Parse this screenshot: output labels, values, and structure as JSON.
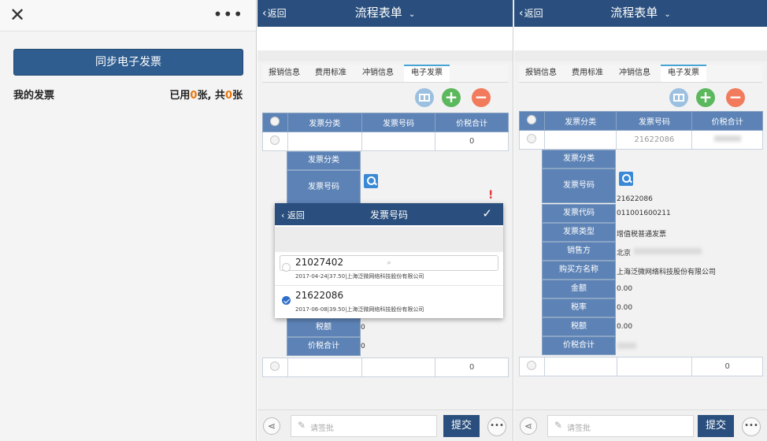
{
  "panel1": {
    "close_icon": "close-icon",
    "more_icon": "more-icon",
    "sync_button": "同步电子发票",
    "my_invoices": "我的发票",
    "count_prefix": "已用",
    "count_used": "0",
    "count_mid": "张, 共",
    "count_total": "0",
    "count_suffix": "张"
  },
  "header": {
    "back": "返回",
    "title": "流程表单"
  },
  "tabs": [
    "报销信息",
    "费用标准",
    "冲销信息",
    "电子发票"
  ],
  "table": {
    "headers": [
      "发票分类",
      "发票号码",
      "价税合计"
    ],
    "row_value": "0"
  },
  "panel2": {
    "detail_labels": [
      "发票分类",
      "发票号码",
      "税额",
      "价税合计"
    ],
    "detail_values": [
      "0",
      "0"
    ],
    "alert": "!",
    "popup": {
      "back": "返回",
      "title": "发票号码",
      "ok": "✓",
      "search_icon": "search-icon",
      "items": [
        {
          "no": "21027402",
          "sub": "2017-04-24|37.50|上海泛微网络科技股份有限公司",
          "selected": false
        },
        {
          "no": "21622086",
          "sub": "2017-06-08|39.50|上海泛微网络科技股份有限公司",
          "selected": true
        }
      ]
    },
    "bottom_row_value": "0"
  },
  "panel3": {
    "row_invoice_no": "21622086",
    "detail_labels": [
      "发票分类",
      "发票号码",
      "发票代码",
      "发票类型",
      "销售方",
      "购买方名称",
      "金额",
      "税率",
      "税额",
      "价税合计"
    ],
    "detail_values": {
      "invoice_no": "21622086",
      "invoice_code": "011001600211",
      "invoice_type": "增值税普通发票",
      "seller": "北京",
      "buyer": "上海泛微网络科技股份有限公司",
      "amount": "0.00",
      "tax_rate": "0.00",
      "tax": "0.00"
    },
    "bottom_row_value": "0"
  },
  "footer": {
    "share_icon": "share-icon",
    "placeholder": "请签批",
    "submit": "提交",
    "more": "•••"
  },
  "colors": {
    "header_blue": "#2a4f7e",
    "table_header": "#5d83b6",
    "accent_orange": "#e8760a",
    "add_green": "#5cb85c",
    "delete_red": "#f17b5c"
  }
}
